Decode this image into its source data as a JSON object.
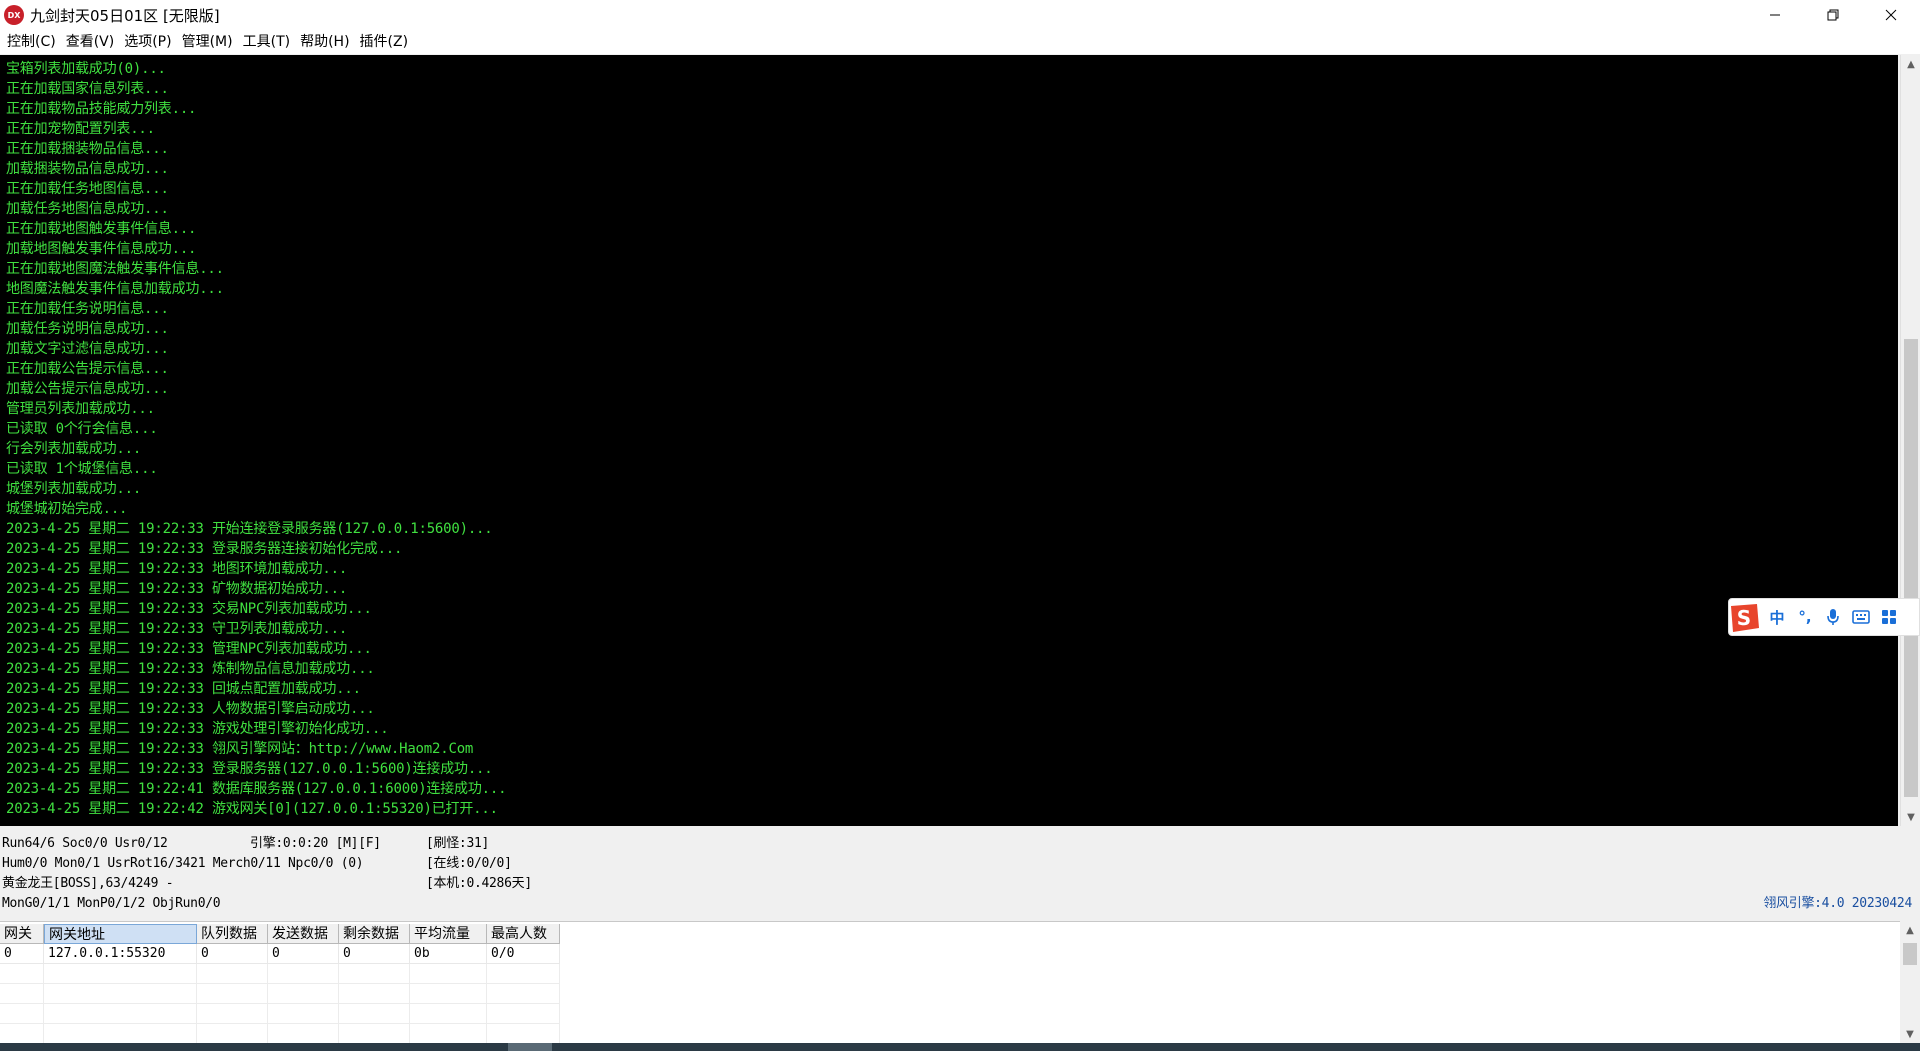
{
  "window": {
    "title": "九剑封天05日01区 [无限版]",
    "icon_label": "DX",
    "controls": [
      "minimize",
      "maximize",
      "close"
    ]
  },
  "menu": [
    "控制(C)",
    "查看(V)",
    "选项(P)",
    "管理(M)",
    "工具(T)",
    "帮助(H)",
    "插件(Z)"
  ],
  "log": [
    "宝箱列表加载成功(0)...",
    "正在加载国家信息列表...",
    "正在加载物品技能威力列表...",
    "正在加宠物配置列表...",
    "正在加载捆装物品信息...",
    "加载捆装物品信息成功...",
    "正在加载任务地图信息...",
    "加载任务地图信息成功...",
    "正在加载地图触发事件信息...",
    "加载地图触发事件信息成功...",
    "正在加载地图魔法触发事件信息...",
    "地图魔法触发事件信息加载成功...",
    "正在加载任务说明信息...",
    "加载任务说明信息成功...",
    "加载文字过滤信息成功...",
    "正在加载公告提示信息...",
    "加载公告提示信息成功...",
    "管理员列表加载成功...",
    "已读取 0个行会信息...",
    "行会列表加载成功...",
    "已读取 1个城堡信息...",
    "城堡列表加载成功...",
    "城堡城初始完成...",
    "2023-4-25 星期二 19:22:33 开始连接登录服务器(127.0.0.1:5600)...",
    "2023-4-25 星期二 19:22:33 登录服务器连接初始化完成...",
    "2023-4-25 星期二 19:22:33 地图环境加载成功...",
    "2023-4-25 星期二 19:22:33 矿物数据初始成功...",
    "2023-4-25 星期二 19:22:33 交易NPC列表加载成功...",
    "2023-4-25 星期二 19:22:33 守卫列表加载成功...",
    "2023-4-25 星期二 19:22:33 管理NPC列表加载成功...",
    "2023-4-25 星期二 19:22:33 炼制物品信息加载成功...",
    "2023-4-25 星期二 19:22:33 回城点配置加载成功...",
    "2023-4-25 星期二 19:22:33 人物数据引擎启动成功...",
    "2023-4-25 星期二 19:22:33 游戏处理引擎初始化成功...",
    "2023-4-25 星期二 19:22:33 翎风引擎网站：http://www.Haom2.Com",
    "2023-4-25 星期二 19:22:33 登录服务器(127.0.0.1:5600)连接成功...",
    "2023-4-25 星期二 19:22:41 数据库服务器(127.0.0.1:6000)连接成功...",
    "2023-4-25 星期二 19:22:42 游戏网关[0](127.0.0.1:55320)已打开..."
  ],
  "ime": {
    "items": [
      "中",
      "°,",
      "mic",
      "keyboard",
      "grid"
    ]
  },
  "status": {
    "run": "Run64/6 Soc0/0 Usr0/12",
    "engine": "引擎:0:0:20 [M][F]",
    "refresh": "[刷怪:31]",
    "hum": "Hum0/0 Mon0/1 UsrRot16/3421 Merch0/11 Npc0/0 (0)",
    "online": "[在线:0/0/0]",
    "boss": "黄金龙王[BOSS],63/4249 -",
    "local": "[本机:0.4286天]",
    "mong": "MonG0/1/1 MonP0/1/2 ObjRun0/0",
    "version": "翎风引擎:4.0 20230424"
  },
  "gateway_table": {
    "headers": [
      "网关",
      "网关地址",
      "队列数据",
      "发送数据",
      "剩余数据",
      "平均流量",
      "最高人数"
    ],
    "rows": [
      [
        "0",
        "127.0.0.1:55320",
        "0",
        "0",
        "0",
        "0b",
        "0/0"
      ]
    ]
  }
}
